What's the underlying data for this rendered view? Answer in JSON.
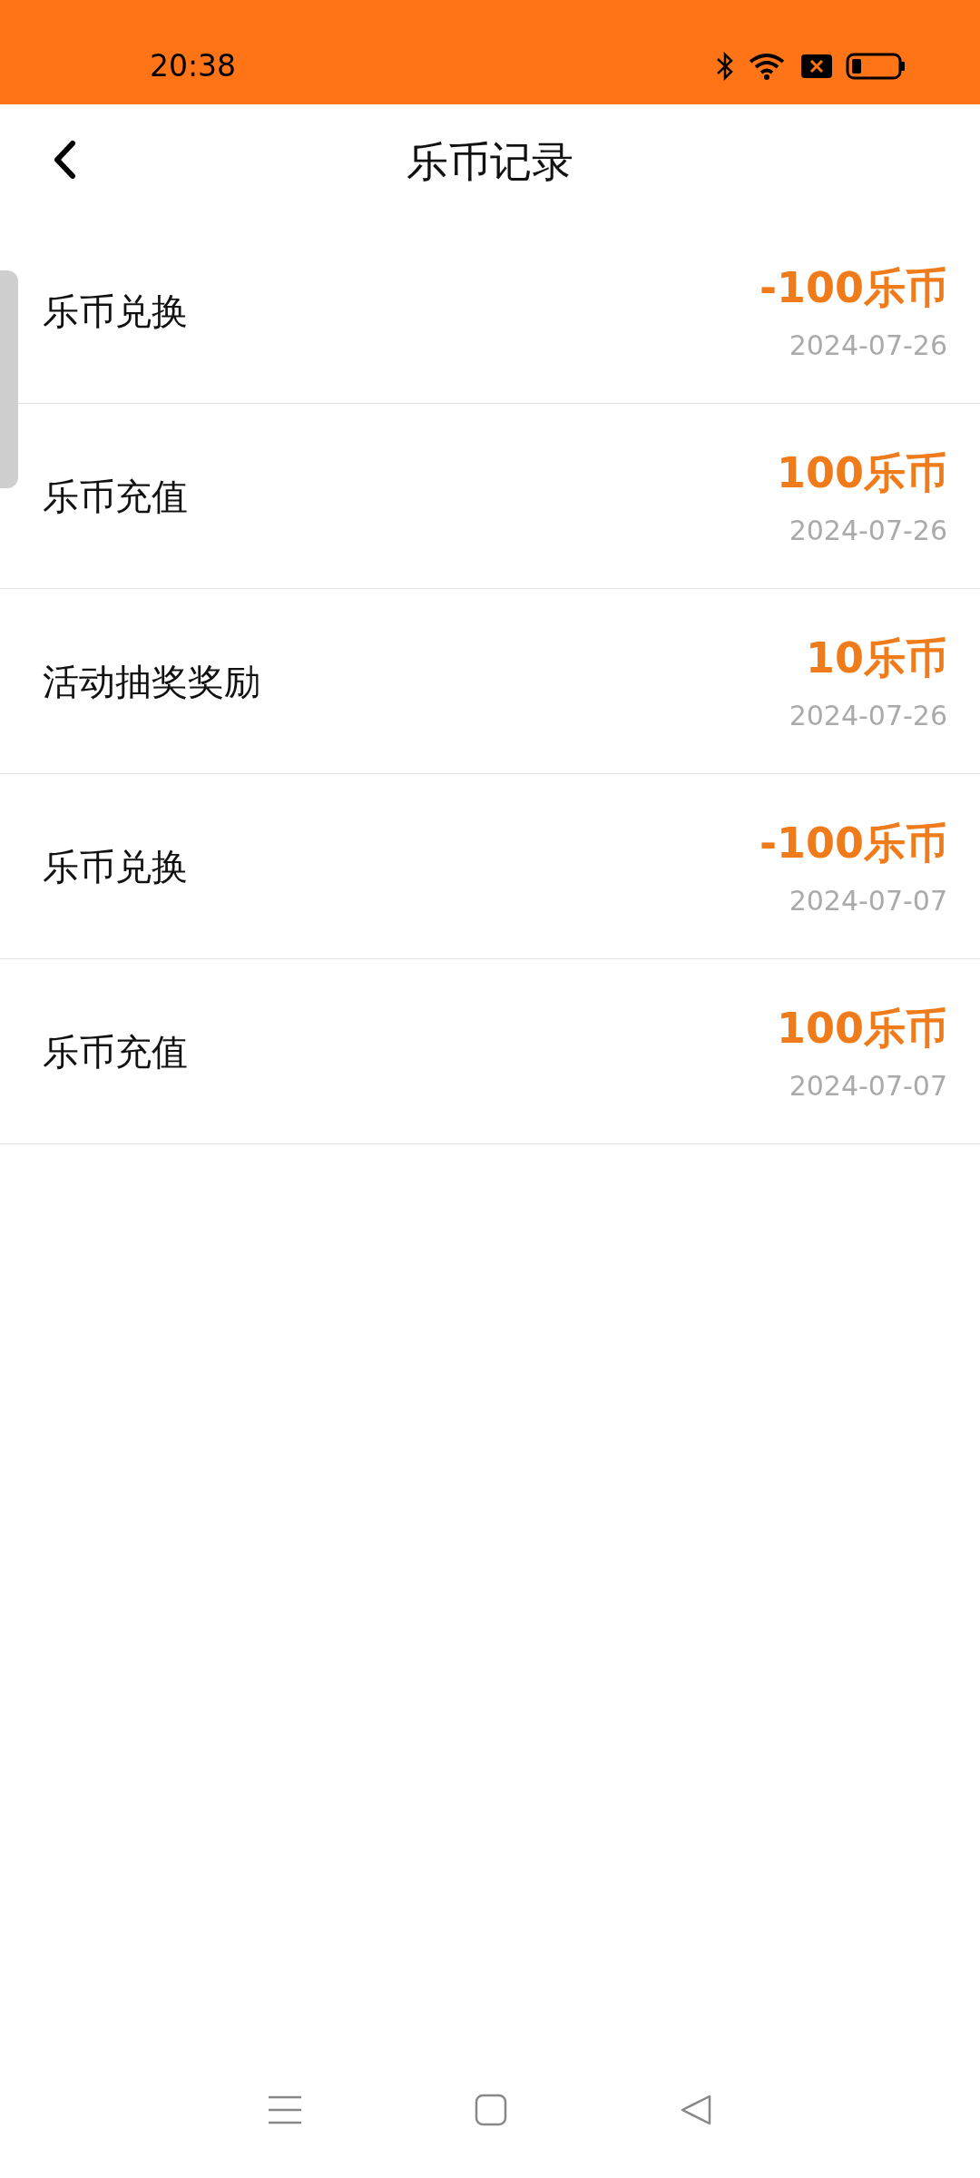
{
  "status_bar": {
    "time": "20:38"
  },
  "header": {
    "title": "乐币记录"
  },
  "records": [
    {
      "title": "乐币兑换",
      "amount": "-100乐币",
      "date": "2024-07-26"
    },
    {
      "title": "乐币充值",
      "amount": "100乐币",
      "date": "2024-07-26"
    },
    {
      "title": "活动抽奖奖励",
      "amount": "10乐币",
      "date": "2024-07-26"
    },
    {
      "title": "乐币兑换",
      "amount": "-100乐币",
      "date": "2024-07-07"
    },
    {
      "title": "乐币充值",
      "amount": "100乐币",
      "date": "2024-07-07"
    }
  ]
}
